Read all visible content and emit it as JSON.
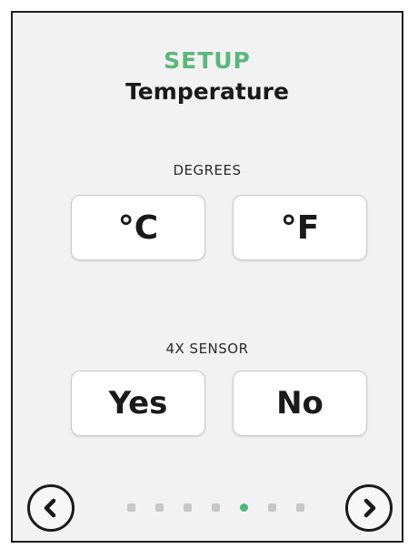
{
  "header": {
    "setup_label": "SETUP",
    "title": "Temperature"
  },
  "degrees": {
    "label": "DEGREES",
    "options": [
      "°C",
      "°F"
    ]
  },
  "sensor": {
    "label": "4X SENSOR",
    "options": [
      "Yes",
      "No"
    ]
  },
  "pager": {
    "total_pages": 7,
    "current_page": 5
  },
  "colors": {
    "accent": "#5ab87a",
    "active_dot": "#4cb97a",
    "inactive_dot": "#c8c8c8",
    "screen_bg": "#f2f2f2"
  },
  "icons": {
    "prev": "chevron-left-icon",
    "next": "chevron-right-icon"
  }
}
